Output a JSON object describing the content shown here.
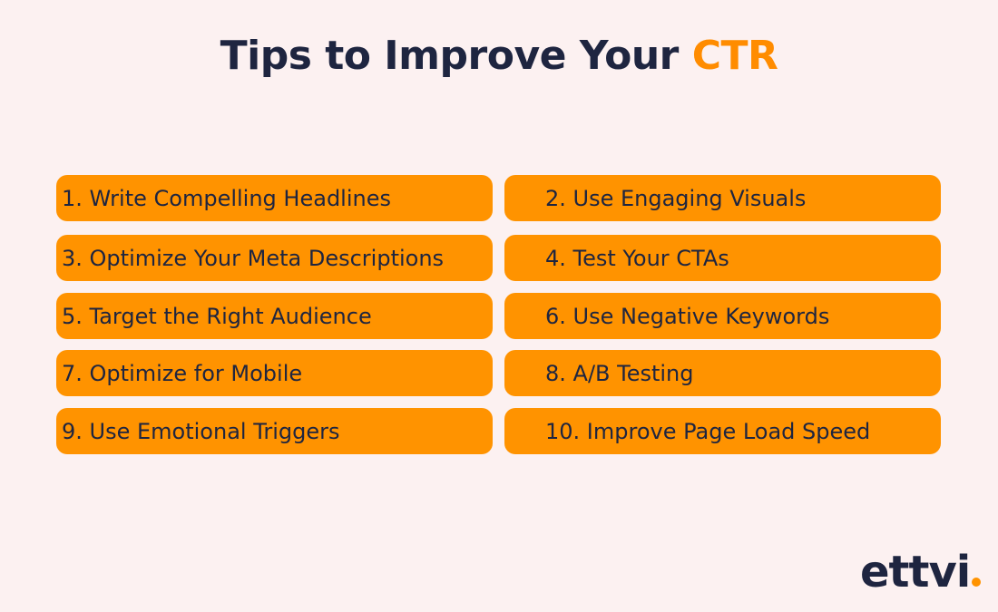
{
  "header": {
    "title_main": "Tips to Improve Your ",
    "title_accent": "CTR"
  },
  "tips": [
    {
      "label": "1. Write Compelling Headlines"
    },
    {
      "label": "2. Use Engaging Visuals"
    },
    {
      "label": "3. Optimize Your Meta Descriptions"
    },
    {
      "label": "4. Test Your CTAs"
    },
    {
      "label": "5. Target the Right Audience"
    },
    {
      "label": "6. Use Negative Keywords"
    },
    {
      "label": "7. Optimize for Mobile"
    },
    {
      "label": "8. A/B Testing"
    },
    {
      "label": "9. Use Emotional Triggers"
    },
    {
      "label": "10. Improve Page Load Speed"
    }
  ],
  "brand": {
    "logo_text": "ettvi",
    "accent_color": "#ff9300",
    "text_color": "#1e2540"
  }
}
